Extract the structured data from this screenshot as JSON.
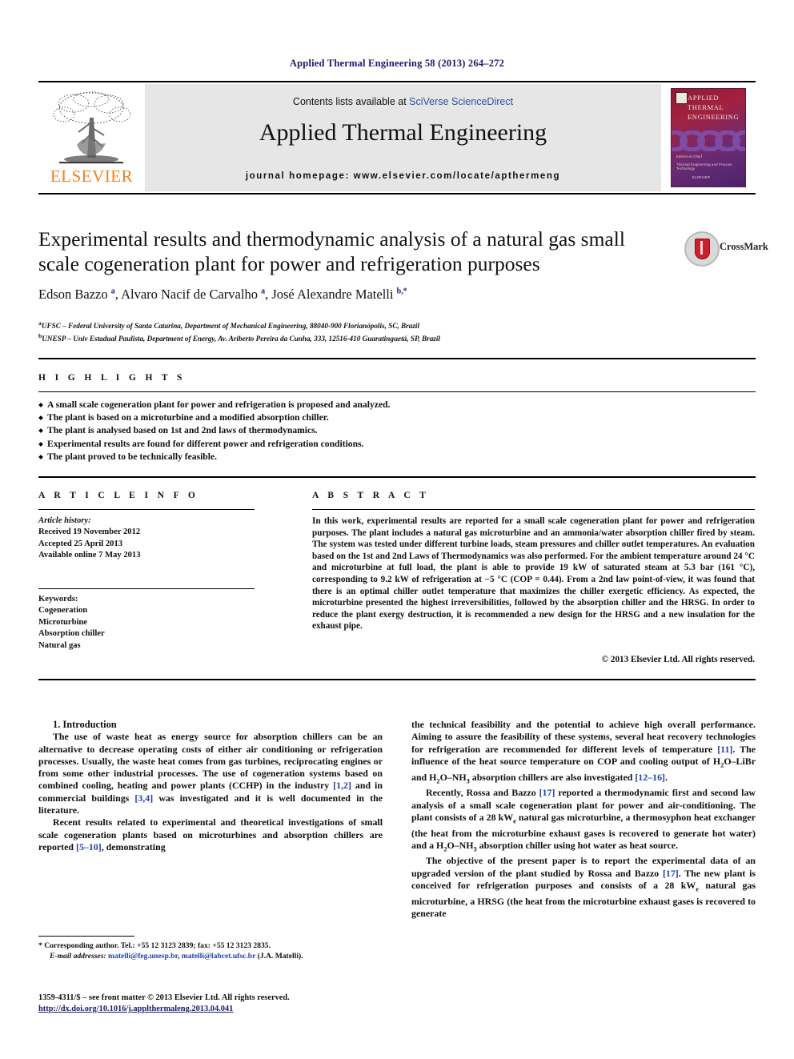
{
  "running_head": "Applied Thermal Engineering 58 (2013) 264–272",
  "masthead": {
    "publisher": "ELSEVIER",
    "publisher_logo": "elsevier-tree-logo",
    "contents_prefix": "Contents lists available at ",
    "contents_link": "SciVerse ScienceDirect",
    "journal_title": "Applied Thermal Engineering",
    "homepage": "journal homepage: www.elsevier.com/locate/apthermeng",
    "cover": {
      "line1": "APPLIED",
      "line2": "THERMAL",
      "line3": "ENGINEERING",
      "footer1": "Editors-in-Chief",
      "footer2": "Thermal Engineering and Process Technology",
      "publisher": "ELSEVIER"
    }
  },
  "article": {
    "title": "Experimental results and thermodynamic analysis of a natural gas small scale cogeneration plant for power and refrigeration purposes",
    "authors_html": "Edson Bazzo <sup>a</sup>, Alvaro Nacif de Carvalho <sup>a</sup>, José Alexandre Matelli <sup>b,</sup><sup>*</sup>",
    "affiliations": [
      "UFSC – Federal University of Santa Catarina, Department of Mechanical Engineering, 88040-900 Florianópolis, SC, Brazil",
      "UNESP – Univ Estadual Paulista, Department of Energy, Av. Ariberto Pereira da Cunha, 333, 12516-410 Guaratinguetá, SP, Brazil"
    ],
    "crossmark_label": "CrossMark"
  },
  "highlights": {
    "heading": "H I G H L I G H T S",
    "items": [
      "A small scale cogeneration plant for power and refrigeration is proposed and analyzed.",
      "The plant is based on a microturbine and a modified absorption chiller.",
      "The plant is analysed based on 1st and 2nd laws of thermodynamics.",
      "Experimental results are found for different power and refrigeration conditions.",
      "The plant proved to be technically feasible."
    ]
  },
  "article_info": {
    "heading": "A R T I C L E   I N F O",
    "history_label": "Article history:",
    "history": [
      "Received 19 November 2012",
      "Accepted 25 April 2013",
      "Available online 7 May 2013"
    ],
    "keywords_label": "Keywords:",
    "keywords": [
      "Cogeneration",
      "Microturbine",
      "Absorption chiller",
      "Natural gas"
    ]
  },
  "abstract": {
    "heading": "A B S T R A C T",
    "text": "In this work, experimental results are reported for a small scale cogeneration plant for power and refrigeration purposes. The plant includes a natural gas microturbine and an ammonia/water absorption chiller fired by steam. The system was tested under different turbine loads, steam pressures and chiller outlet temperatures. An evaluation based on the 1st and 2nd Laws of Thermodynamics was also performed. For the ambient temperature around 24 °C and microturbine at full load, the plant is able to provide 19 kW of saturated steam at 5.3 bar (161 °C), corresponding to 9.2 kW of refrigeration at −5 °C (COP = 0.44). From a 2nd law point-of-view, it was found that there is an optimal chiller outlet temperature that maximizes the chiller exergetic efficiency. As expected, the microturbine presented the highest irreversibilities, followed by the absorption chiller and the HRSG. In order to reduce the plant exergy destruction, it is recommended a new design for the HRSG and a new insulation for the exhaust pipe.",
    "copyright": "© 2013 Elsevier Ltd. All rights reserved."
  },
  "body": {
    "section_number": "1.",
    "section_title": "Introduction",
    "left_paragraphs": [
      "The use of waste heat as energy source for absorption chillers can be an alternative to decrease operating costs of either air conditioning or refrigeration processes. Usually, the waste heat comes from gas turbines, reciprocating engines or from some other industrial processes. The use of cogeneration systems based on combined cooling, heating and power plants (CCHP) in the industry [1,2] and in commercial buildings [3,4] was investigated and it is well documented in the literature.",
      "Recent results related to experimental and theoretical investigations of small scale cogeneration plants based on microturbines and absorption chillers are reported [5–10], demonstrating"
    ],
    "right_paragraphs": [
      "the technical feasibility and the potential to achieve high overall performance. Aiming to assure the feasibility of these systems, several heat recovery technologies for refrigeration are recommended for different levels of temperature [11]. The influence of the heat source temperature on COP and cooling output of H2O–LiBr and H2O–NH3 absorption chillers are also investigated [12–16].",
      "Recently, Rossa and Bazzo [17] reported a thermodynamic first and second law analysis of a small scale cogeneration plant for power and air-conditioning. The plant consists of a 28 kWe natural gas microturbine, a thermosyphon heat exchanger (the heat from the microturbine exhaust gases is recovered to generate hot water) and a H2O–NH3 absorption chiller using hot water as heat source.",
      "The objective of the present paper is to report the experimental data of an upgraded version of the plant studied by Rossa and Bazzo [17]. The new plant is conceived for refrigeration purposes and consists of a 28 kWe natural gas microturbine, a HRSG (the heat from the microturbine exhaust gases is recovered to generate"
    ]
  },
  "footnotes": {
    "corresponding": "* Corresponding author. Tel.: +55 12 3123 2839; fax: +55 12 3123 2835.",
    "email_label": "E-mail addresses:",
    "emails": [
      "matelli@feg.unesp.br",
      "matelli@labcet.ufsc.br"
    ],
    "email_attrib": "(J.A. Matelli).",
    "front_matter": "1359-4311/$ – see front matter © 2013 Elsevier Ltd. All rights reserved.",
    "doi": "http://dx.doi.org/10.1016/j.applthermaleng.2013.04.041"
  },
  "colors": {
    "link": "#2340a8",
    "navy": "#1a1a6e",
    "elsevier_orange": "#f08020",
    "masthead_grey": "#e6e6e6",
    "crossmark_red": "#c8202c"
  }
}
